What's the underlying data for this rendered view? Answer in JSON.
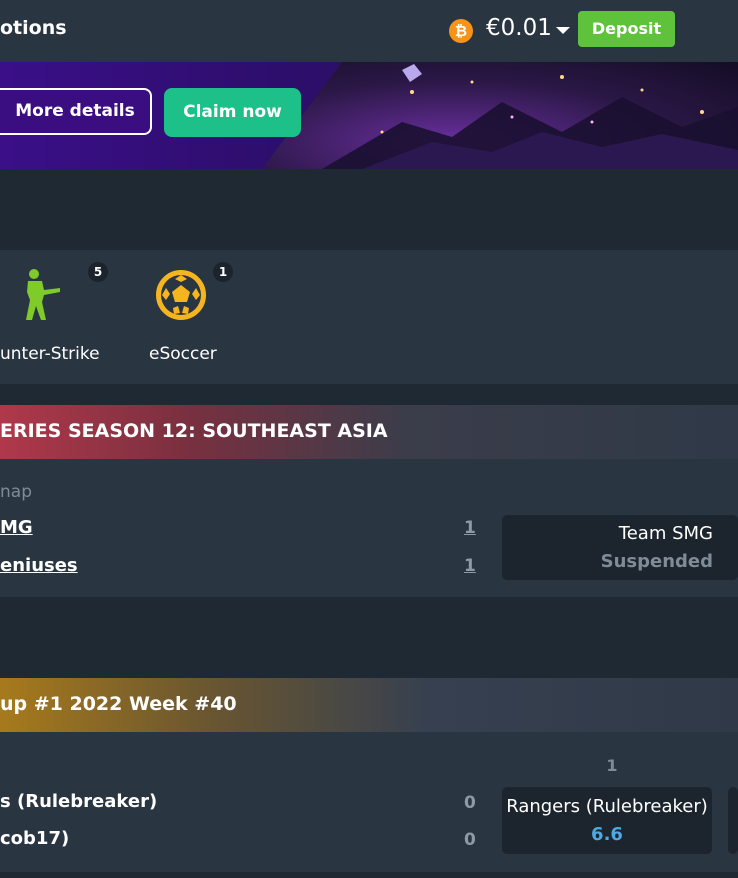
{
  "header": {
    "nav_title": "otions",
    "currency_icon": "bitcoin-icon",
    "currency_symbol": "₿",
    "balance": "€0.01",
    "deposit_label": "Deposit"
  },
  "banner": {
    "more_details_label": "More details",
    "claim_label": "Claim now"
  },
  "sports": [
    {
      "label": "unter-Strike",
      "count": "5",
      "icon": "counter-strike-soldier-icon"
    },
    {
      "label": "eSoccer",
      "count": "1",
      "icon": "soccer-ball-icon"
    }
  ],
  "leagues": [
    {
      "title": "ERIES SEASON 12: SOUTHEAST ASIA",
      "market": "nap",
      "teams": [
        {
          "name": "MG",
          "score": "1"
        },
        {
          "name": "eniuses",
          "score": "1"
        }
      ],
      "odds": {
        "selection": "Team SMG",
        "status": "Suspended"
      }
    },
    {
      "title": "up #1 2022 Week #40",
      "column_header": "1",
      "teams": [
        {
          "name": "s (Rulebreaker)",
          "score": "0"
        },
        {
          "name": "cob17)",
          "score": "0"
        }
      ],
      "odds": {
        "selection": "Rangers (Rulebreaker)",
        "price": "6.6"
      }
    }
  ],
  "colors": {
    "deposit": "#5ec23a",
    "claim": "#1ec08a",
    "odds_price": "#4fa8e0",
    "bitcoin": "#f7931a"
  }
}
